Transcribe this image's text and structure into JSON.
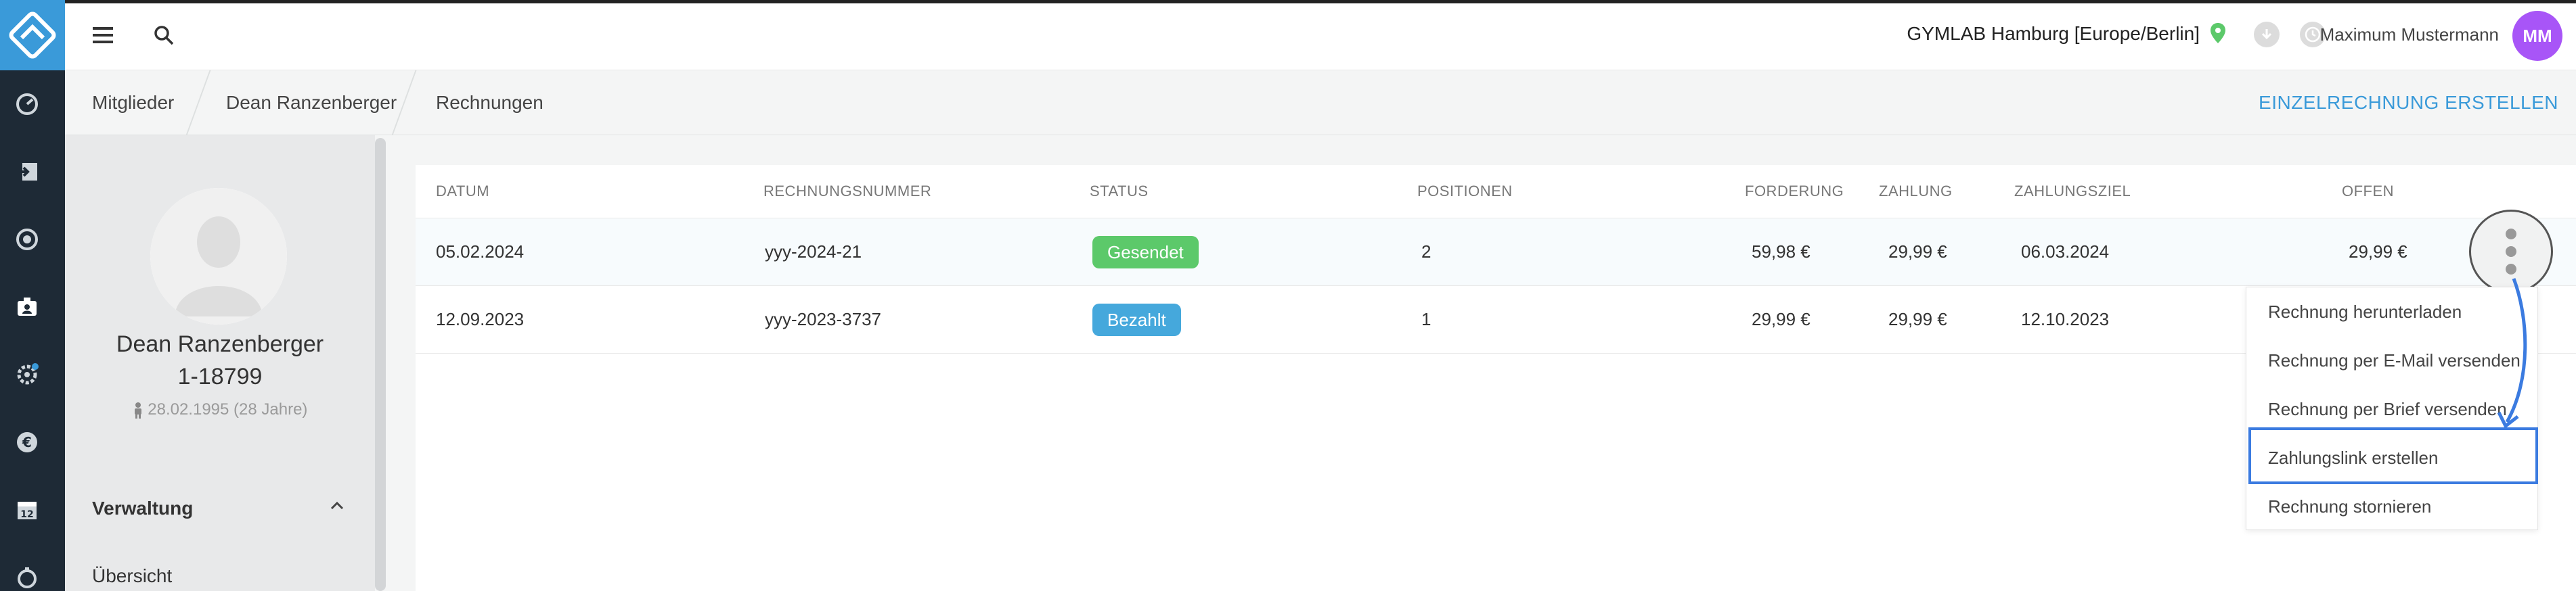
{
  "header": {
    "location": "GYMLAB Hamburg [Europe/Berlin]",
    "username": "Maximum Mustermann",
    "avatar_initials": "MM",
    "avatar_color": "#a855f7",
    "accent_color": "#3a9ad9"
  },
  "breadcrumb": [
    "Mitglieder",
    "Dean Ranzenberger",
    "Rechnungen"
  ],
  "actions": {
    "create_invoice": "EINZELRECHNUNG ERSTELLEN"
  },
  "member": {
    "name": "Dean Ranzenberger",
    "number": "1-18799",
    "dob": "28.02.1995 (28 Jahre)",
    "section": "Verwaltung",
    "overview": "Übersicht"
  },
  "table": {
    "columns": [
      "DATUM",
      "RECHNUNGSNUMMER",
      "STATUS",
      "POSITIONEN",
      "FORDERUNG",
      "ZAHLUNG",
      "ZAHLUNGSZIEL",
      "OFFEN"
    ],
    "rows": [
      {
        "date": "05.02.2024",
        "number": "yyy-2024-21",
        "status": "Gesendet",
        "status_color": "#5cc96a",
        "positions": "2",
        "claim": "59,98 €",
        "payment": "29,99 €",
        "due": "06.03.2024",
        "open": "29,99 €"
      },
      {
        "date": "12.09.2023",
        "number": "yyy-2023-3737",
        "status": "Bezahlt",
        "status_color": "#45a8dc",
        "positions": "1",
        "claim": "29,99 €",
        "payment": "29,99 €",
        "due": "12.10.2023",
        "open": ""
      }
    ]
  },
  "menu": {
    "items": [
      "Rechnung herunterladen",
      "Rechnung per E-Mail versenden",
      "Rechnung per Brief versenden",
      "Zahlungslink erstellen",
      "Rechnung stornieren"
    ],
    "highlight_color": "#3b7be0"
  },
  "icons": {
    "nav": [
      "dashboard-icon",
      "checkin-icon",
      "record-icon",
      "members-icon",
      "settings-icon",
      "euro-icon",
      "calendar-icon",
      "timer-icon"
    ]
  }
}
